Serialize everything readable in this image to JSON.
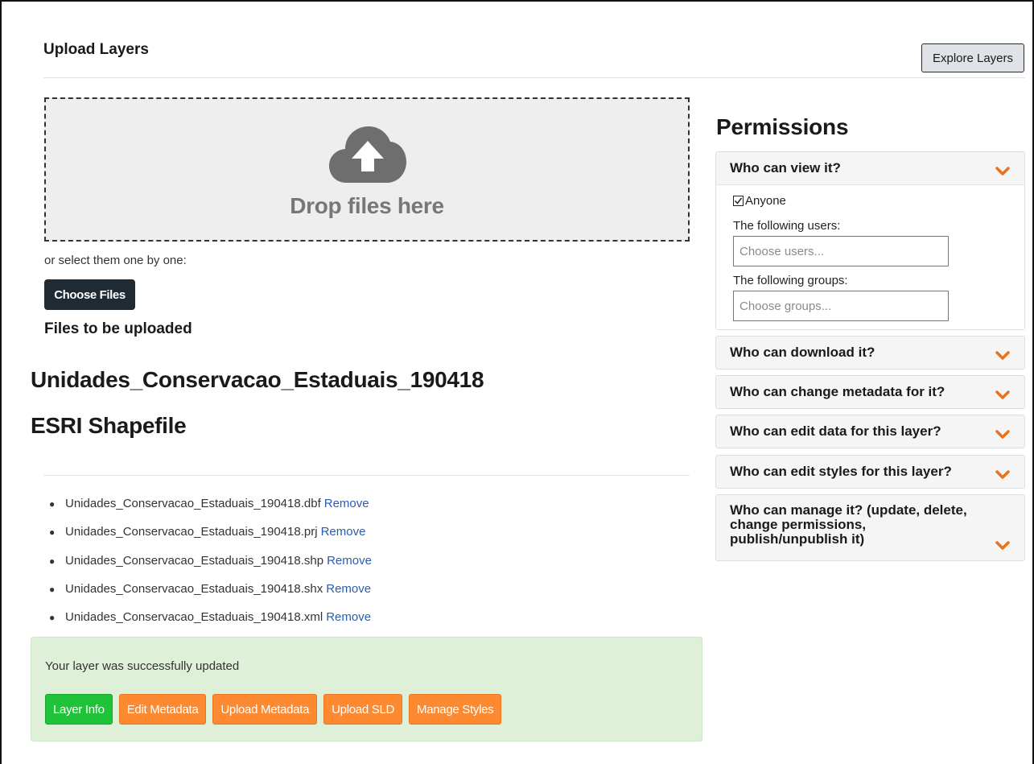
{
  "page": {
    "title": "Upload Layers",
    "explore_label": "Explore Layers"
  },
  "upload": {
    "drop_text": "Drop files here",
    "select_hint": "or select them one by one:",
    "choose_label": "Choose Files",
    "files_heading": "Files to be uploaded",
    "layer_name": "Unidades_Conservacao_Estaduais_190418",
    "layer_type": "ESRI Shapefile",
    "remove_label": "Remove",
    "files": [
      "Unidades_Conservacao_Estaduais_190418.dbf",
      "Unidades_Conservacao_Estaduais_190418.prj",
      "Unidades_Conservacao_Estaduais_190418.shp",
      "Unidades_Conservacao_Estaduais_190418.shx",
      "Unidades_Conservacao_Estaduais_190418.xml"
    ]
  },
  "alert": {
    "message": "Your layer was successfully updated",
    "buttons": [
      "Layer Info",
      "Edit Metadata",
      "Upload Metadata",
      "Upload SLD",
      "Manage Styles"
    ]
  },
  "permissions": {
    "title": "Permissions",
    "view": {
      "title": "Who can view it?",
      "anyone_label": "Anyone",
      "users_label": "The following users:",
      "users_placeholder": "Choose users...",
      "groups_label": "The following groups:",
      "groups_placeholder": "Choose groups..."
    },
    "panels": [
      "Who can download it?",
      "Who can change metadata for it?",
      "Who can edit data for this layer?",
      "Who can edit styles for this layer?",
      "Who can manage it? (update, delete, change permissions, publish/unpublish it)"
    ]
  },
  "colors": {
    "accent_orange": "#fd8a31",
    "success_green": "#1ec33a",
    "link_blue": "#2a5db0",
    "alert_bg": "#dff0d8"
  }
}
